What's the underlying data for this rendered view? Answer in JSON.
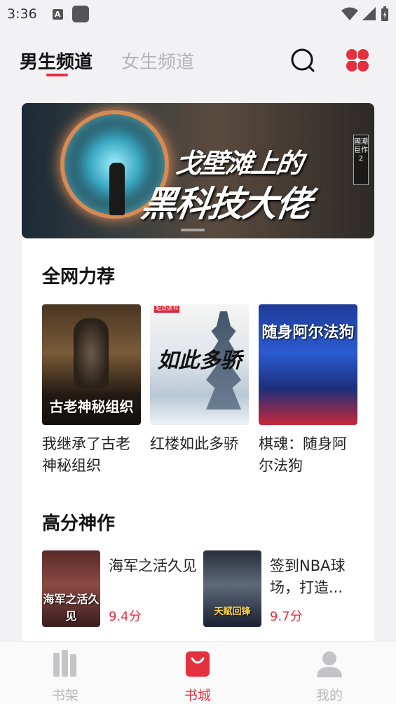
{
  "status_bar": {
    "time": "3:36",
    "notif_icon_letter": "A"
  },
  "header": {
    "tab_male": "男生频道",
    "tab_female": "女生频道",
    "accent_color": "#e5303f"
  },
  "banner": {
    "title_line1": "戈壁滩上的",
    "title_line2": "黑科技大佬",
    "badge": "國潮巨作2"
  },
  "section_recommend": {
    "title": "全网力荐",
    "books": [
      {
        "title": "我继承了古老神秘组织",
        "cover_text": "古老神秘组织"
      },
      {
        "title": "红楼如此多骄",
        "cover_text": "如此多骄",
        "cover_tag": "起点读书"
      },
      {
        "title": "棋魂：随身阿尔法狗",
        "cover_text": "随身阿尔法狗"
      }
    ]
  },
  "section_high_score": {
    "title": "高分神作",
    "books": [
      {
        "title": "海军之活久见",
        "score": "9.4分",
        "cover_text": "海军之活久见"
      },
      {
        "title": "签到NBA球场，打造...",
        "score": "9.7分",
        "cover_text": "天赋回锋"
      }
    ]
  },
  "bottom_nav": {
    "items": [
      {
        "label": "书架",
        "icon": "bookshelf-icon",
        "active": false
      },
      {
        "label": "书城",
        "icon": "store-bag-icon",
        "active": true
      },
      {
        "label": "我的",
        "icon": "person-icon",
        "active": false
      }
    ]
  }
}
